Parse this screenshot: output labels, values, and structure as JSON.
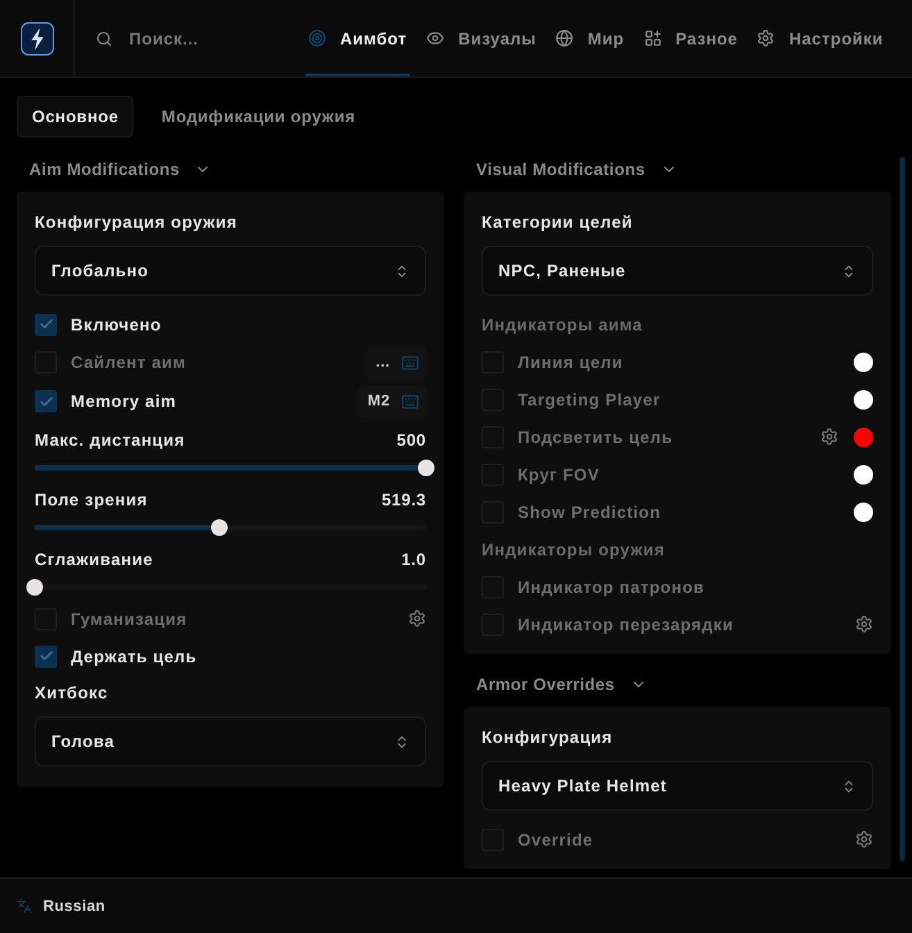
{
  "header": {
    "search": {
      "placeholder": "Поиск..."
    },
    "tabs": [
      {
        "label": "Аимбот",
        "selected": true
      },
      {
        "label": "Визуалы",
        "selected": false
      },
      {
        "label": "Мир",
        "selected": false
      },
      {
        "label": "Разное",
        "selected": false
      },
      {
        "label": "Настройки",
        "selected": false
      }
    ]
  },
  "subtabs": [
    {
      "label": "Основное",
      "selected": true
    },
    {
      "label": "Модификации оружия",
      "selected": false
    }
  ],
  "columns": [
    {
      "sections": [
        {
          "title": "Aim Modifications",
          "expanded": true,
          "items": [
            {
              "kind": "heading",
              "label": "Конфигурация оружия"
            },
            {
              "kind": "select",
              "value": "Глобально"
            },
            {
              "kind": "checkbox",
              "label": "Включено",
              "checked": true
            },
            {
              "kind": "checkbox",
              "label": "Сайлент аим",
              "checked": false,
              "keybind": "..."
            },
            {
              "kind": "checkbox",
              "label": "Memory aim",
              "checked": true,
              "keybind": "M2"
            },
            {
              "kind": "slider",
              "label": "Макс. дистанция",
              "reading": "500",
              "level": 1
            },
            {
              "kind": "slider",
              "label": "Поле зрения",
              "reading": "519.3",
              "level": 0.47
            },
            {
              "kind": "slider",
              "label": "Сглаживание",
              "reading": "1.0",
              "level": 0
            },
            {
              "kind": "checkbox",
              "label": "Гуманизация",
              "checked": false,
              "settings": true
            },
            {
              "kind": "checkbox",
              "label": "Держать цель",
              "checked": true
            },
            {
              "kind": "heading",
              "label": "Хитбокс"
            },
            {
              "kind": "select",
              "value": "Голова"
            }
          ]
        }
      ]
    },
    {
      "sections": [
        {
          "title": "Visual Modifications",
          "expanded": true,
          "items": [
            {
              "kind": "heading",
              "label": "Категории целей"
            },
            {
              "kind": "select",
              "value": "NPC, Раненые"
            },
            {
              "kind": "group",
              "label": "Индикаторы аима"
            },
            {
              "kind": "checkbox",
              "label": "Линия цели",
              "checked": false,
              "color": "#ffffff"
            },
            {
              "kind": "checkbox",
              "label": "Targeting Player",
              "checked": false,
              "color": "#ffffff"
            },
            {
              "kind": "checkbox",
              "label": "Подсветить цель",
              "checked": false,
              "settings": true,
              "color": "#ff0000"
            },
            {
              "kind": "checkbox",
              "label": "Круг FOV",
              "checked": false,
              "color": "#ffffff"
            },
            {
              "kind": "checkbox",
              "label": "Show Prediction",
              "checked": false,
              "color": "#ffffff"
            },
            {
              "kind": "group",
              "label": "Индикаторы оружия"
            },
            {
              "kind": "checkbox",
              "label": "Индикатор патронов",
              "checked": false
            },
            {
              "kind": "checkbox",
              "label": "Индикатор перезарядки",
              "checked": false,
              "settings": true
            }
          ]
        },
        {
          "title": "Armor Overrides",
          "expanded": true,
          "items": [
            {
              "kind": "heading",
              "label": "Конфигурация"
            },
            {
              "kind": "select",
              "value": "Heavy Plate Helmet"
            },
            {
              "kind": "checkbox",
              "label": "Override",
              "checked": false,
              "settings": true
            }
          ]
        }
      ]
    }
  ],
  "footer": {
    "language": "Russian"
  }
}
